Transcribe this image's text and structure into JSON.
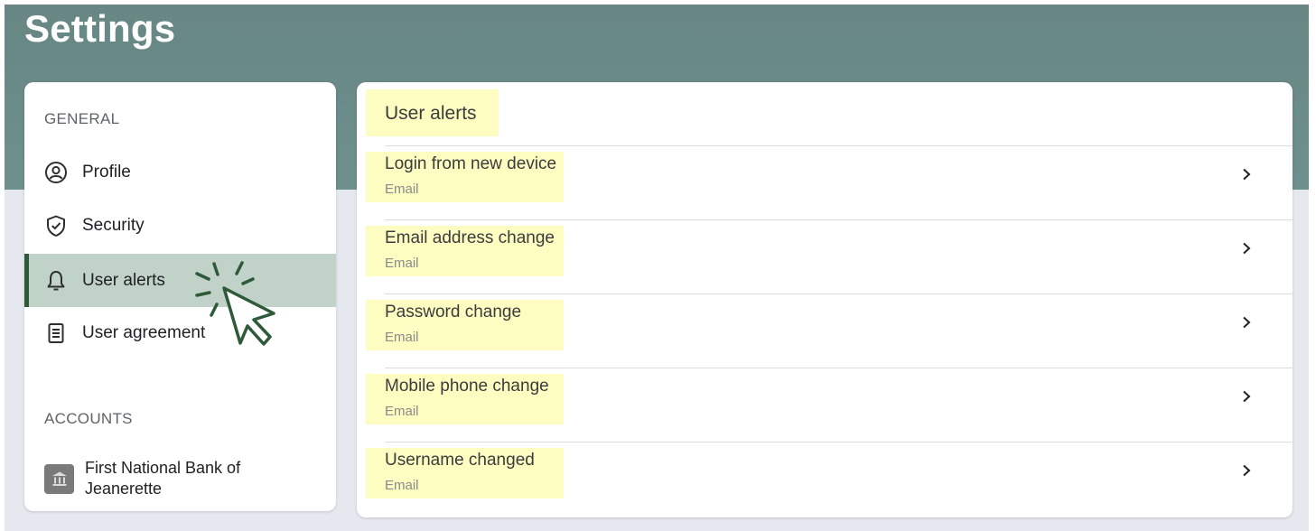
{
  "header": {
    "title": "Settings"
  },
  "sidebar": {
    "general_label": "GENERAL",
    "items": [
      {
        "label": "Profile",
        "icon": "profile-icon"
      },
      {
        "label": "Security",
        "icon": "shield-icon"
      },
      {
        "label": "User alerts",
        "icon": "bell-icon",
        "active": true
      },
      {
        "label": "User agreement",
        "icon": "document-icon"
      }
    ],
    "accounts_label": "ACCOUNTS",
    "accounts": [
      {
        "name": "First National Bank of Jeanerette",
        "icon": "bank-icon"
      }
    ]
  },
  "panel": {
    "title": "User alerts",
    "alerts": [
      {
        "title": "Login from new device",
        "channel": "Email"
      },
      {
        "title": "Email address change",
        "channel": "Email"
      },
      {
        "title": "Password change",
        "channel": "Email"
      },
      {
        "title": "Mobile phone change",
        "channel": "Email"
      },
      {
        "title": "Username changed",
        "channel": "Email"
      }
    ]
  },
  "colors": {
    "header_band": "#6a8a88",
    "active_item": "#c1d2c9",
    "active_accent": "#2e5a3a",
    "highlight": "#fdfdc2",
    "page_background": "#e6e8ef"
  }
}
